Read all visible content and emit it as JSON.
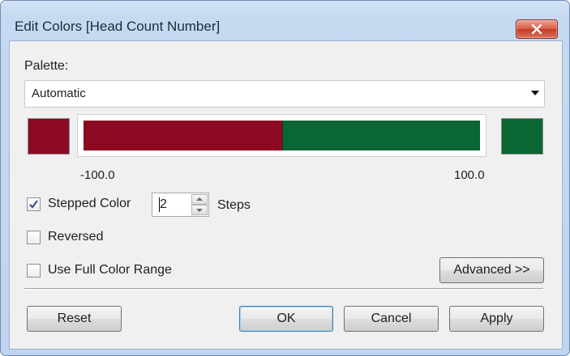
{
  "window": {
    "title": "Edit Colors [Head Count Number]"
  },
  "palette": {
    "label": "Palette:",
    "selected": "Automatic"
  },
  "gradient": {
    "start_color": "#8b0a22",
    "end_color": "#0a6633",
    "min_label": "-100.0",
    "max_label": "100.0",
    "steps": 2
  },
  "options": {
    "stepped_color": {
      "label": "Stepped Color",
      "checked": true
    },
    "steps_value": "2",
    "steps_label": "Steps",
    "reversed": {
      "label": "Reversed",
      "checked": false
    },
    "full_range": {
      "label": "Use Full Color Range",
      "checked": false
    }
  },
  "buttons": {
    "advanced": "Advanced >>",
    "reset": "Reset",
    "ok": "OK",
    "cancel": "Cancel",
    "apply": "Apply"
  }
}
